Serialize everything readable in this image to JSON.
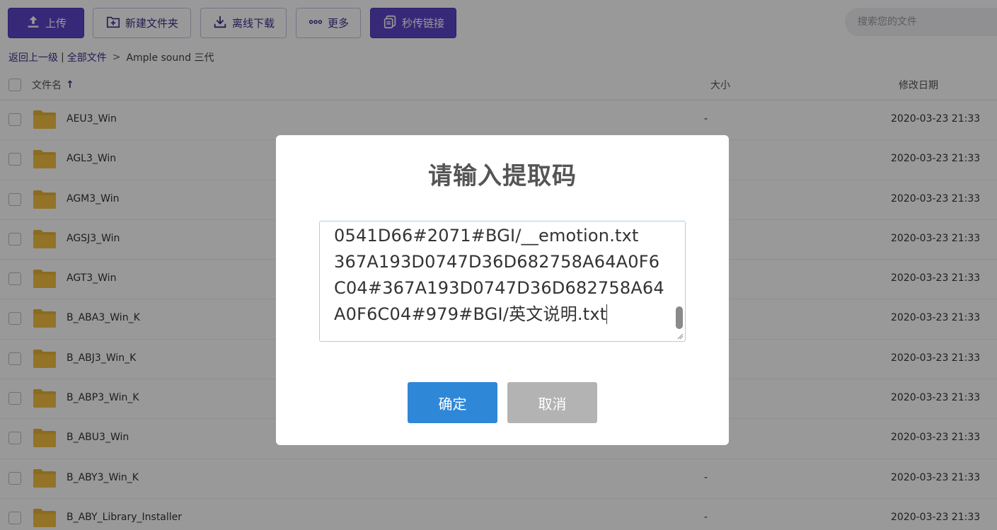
{
  "toolbar": {
    "upload_label": "上传",
    "new_folder_label": "新建文件夹",
    "offline_download_label": "离线下载",
    "more_label": "更多",
    "quick_link_label": "秒传链接",
    "search_placeholder": "搜索您的文件"
  },
  "breadcrumb": {
    "back_label": "返回上一级",
    "divider": "|",
    "all_files_label": "全部文件",
    "separator": ">",
    "current": "Ample sound 三代"
  },
  "table": {
    "headers": {
      "name": "文件名",
      "sort_arrow": "↑",
      "size": "大小",
      "date": "修改日期"
    },
    "rows": [
      {
        "name": "AEU3_Win",
        "size": "-",
        "date": "2020-03-23 21:33"
      },
      {
        "name": "AGL3_Win",
        "size": "",
        "date": "2020-03-23 21:33"
      },
      {
        "name": "AGM3_Win",
        "size": "",
        "date": "2020-03-23 21:33"
      },
      {
        "name": "AGSJ3_Win",
        "size": "",
        "date": "2020-03-23 21:33"
      },
      {
        "name": "AGT3_Win",
        "size": "",
        "date": "2020-03-23 21:33"
      },
      {
        "name": "B_ABA3_Win_K",
        "size": "",
        "date": "2020-03-23 21:33"
      },
      {
        "name": "B_ABJ3_Win_K",
        "size": "",
        "date": "2020-03-23 21:33"
      },
      {
        "name": "B_ABP3_Win_K",
        "size": "",
        "date": "2020-03-23 21:33"
      },
      {
        "name": "B_ABU3_Win",
        "size": "",
        "date": "2020-03-23 21:33"
      },
      {
        "name": "B_ABY3_Win_K",
        "size": "-",
        "date": "2020-03-23 21:33"
      },
      {
        "name": "B_ABY_Library_Installer",
        "size": "-",
        "date": "2020-03-23 21:33"
      }
    ]
  },
  "modal": {
    "title": "请输入提取码",
    "code_lines": [
      "0541D66#2071#BGI/__emotion.txt",
      "367A193D0747D36D682758A64A0F6",
      "C04#367A193D0747D36D682758A64",
      "A0F6C04#979#BGI/英文说明.txt"
    ],
    "confirm_label": "确定",
    "cancel_label": "取消"
  },
  "colors": {
    "primary_purple": "#5c45c8",
    "confirm_blue": "#2f87d8",
    "cancel_gray": "#b3b3b3",
    "folder_yellow": "#f4c042"
  }
}
